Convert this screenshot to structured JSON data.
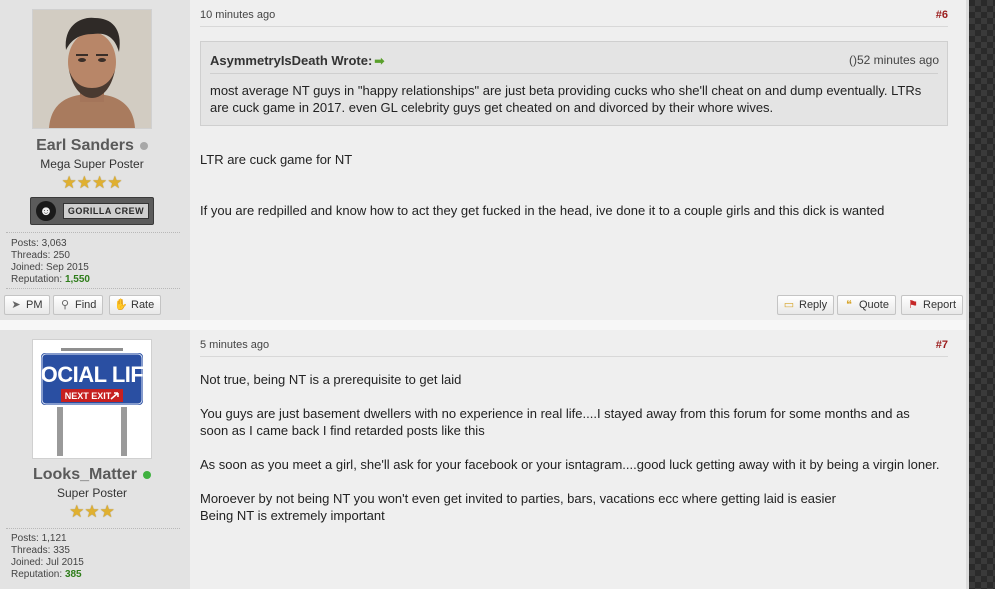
{
  "posts": [
    {
      "user": {
        "name": "Earl Sanders",
        "status": "offline",
        "title": "Mega Super Poster",
        "stars": "★★★★",
        "group_badge": "GORILLA CREW",
        "stats": {
          "posts_label": "Posts:",
          "posts": "3,063",
          "threads_label": "Threads:",
          "threads": "250",
          "joined_label": "Joined:",
          "joined": "Sep 2015",
          "reputation_label": "Reputation:",
          "reputation": "1,550"
        }
      },
      "buttons": {
        "pm": "PM",
        "find": "Find",
        "rate": "Rate"
      },
      "date": "10 minutes ago",
      "number": "#6",
      "quote": {
        "author": "AsymmetryIsDeath Wrote:",
        "time": "()52 minutes ago",
        "text": "most average NT guys in \"happy relationships\" are just beta providing cucks who she'll cheat on and dump eventually. LTRs are cuck game in 2017. even GL celebrity guys get cheated on and divorced by their whore wives."
      },
      "message": [
        "LTR are cuck game for NT",
        "If you are redpilled and know how to act they get fucked in the head, ive done it to a couple girls and this dick is wanted"
      ],
      "actions": {
        "reply": "Reply",
        "quote": "Quote",
        "report": "Report"
      }
    },
    {
      "user": {
        "name": "Looks_Matter",
        "status": "online",
        "title": "Super Poster",
        "stars": "★★★",
        "avatar_sign_line1": "SOCIAL LIFE",
        "avatar_sign_line2": "NEXT EXIT",
        "stats": {
          "posts_label": "Posts:",
          "posts": "1,121",
          "threads_label": "Threads:",
          "threads": "335",
          "joined_label": "Joined:",
          "joined": "Jul 2015",
          "reputation_label": "Reputation:",
          "reputation": "385"
        }
      },
      "date": "5 minutes ago",
      "number": "#7",
      "message": [
        "Not true, being NT is a prerequisite to get laid",
        "You guys are just basement dwellers with no experience in real life....I stayed away from this forum for some months and as soon as I came back I find retarded posts like this",
        "As soon as you meet a girl, she'll ask for your facebook or your isntagram....good luck getting away with it by being a virgin loner.",
        "Moroever by not being NT you won't even get invited to parties, bars, vacations ecc where getting laid is easier",
        "Being NT is extremely important"
      ]
    }
  ],
  "colors": {
    "post_number": "#9b1c1c",
    "reputation": "#2e7d1a",
    "online_dot": "#3fb13f",
    "offline_dot": "#a8a8a8"
  }
}
